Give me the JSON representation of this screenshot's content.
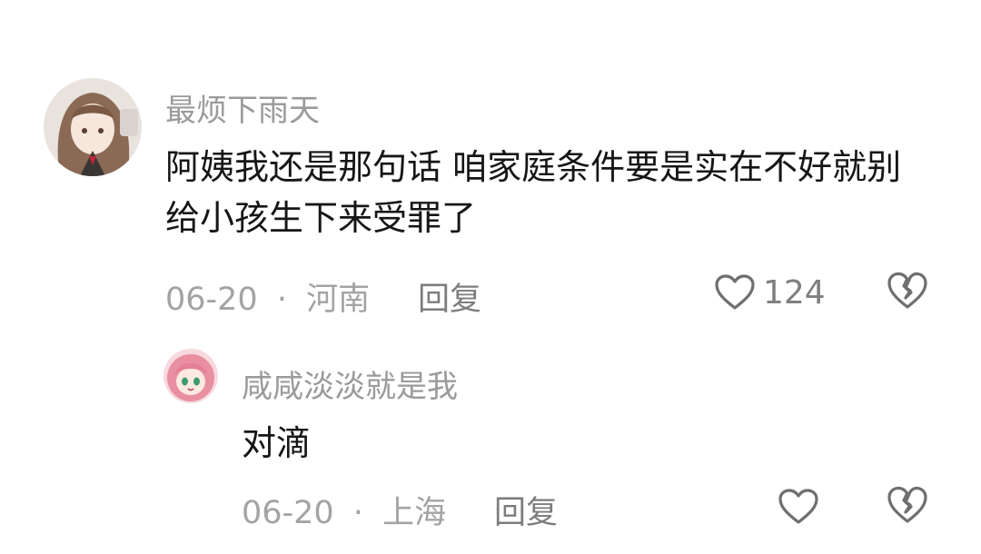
{
  "comments": [
    {
      "username": "最烦下雨天",
      "text": "阿姨我还是那句话 咱家庭条件要是实在不好就别给小孩生下来受罪了",
      "date": "06-20",
      "separator": "·",
      "location": "河南",
      "reply_label": "回复",
      "like_count": "124",
      "avatar_icon": "anime-girl-avatar",
      "like_icon": "heart-outline-icon",
      "dislike_icon": "broken-heart-icon"
    },
    {
      "username": "咸咸淡淡就是我",
      "text": "对滴",
      "date": "06-20",
      "separator": "·",
      "location": "上海",
      "reply_label": "回复",
      "like_count": "",
      "avatar_icon": "anime-girl-pink-hair-avatar",
      "like_icon": "heart-outline-icon",
      "dislike_icon": "broken-heart-icon"
    }
  ],
  "colors": {
    "username": "#9a9a9a",
    "text": "#161616",
    "meta": "#a3a3a3",
    "icon": "#6f6f6f"
  }
}
